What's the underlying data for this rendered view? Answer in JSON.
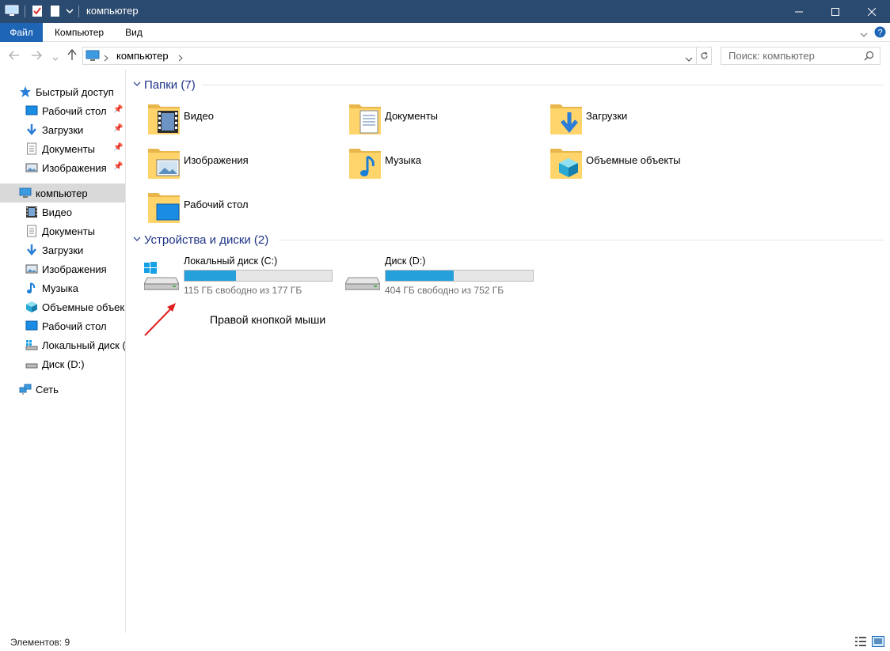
{
  "window": {
    "title": "компьютер"
  },
  "ribbon": {
    "tabs": [
      "Файл",
      "Компьютер",
      "Вид"
    ]
  },
  "address": {
    "crumb": "компьютер"
  },
  "search": {
    "placeholder": "Поиск: компьютер"
  },
  "sidebar": {
    "quick_access": "Быстрый доступ",
    "quick_items": [
      {
        "label": "Рабочий стол",
        "icon": "desktop-icon"
      },
      {
        "label": "Загрузки",
        "icon": "downloads-icon"
      },
      {
        "label": "Документы",
        "icon": "documents-icon"
      },
      {
        "label": "Изображения",
        "icon": "pictures-icon"
      }
    ],
    "computer": "компьютер",
    "computer_items": [
      {
        "label": "Видео",
        "icon": "video-icon"
      },
      {
        "label": "Документы",
        "icon": "documents-icon"
      },
      {
        "label": "Загрузки",
        "icon": "downloads-icon"
      },
      {
        "label": "Изображения",
        "icon": "pictures-icon"
      },
      {
        "label": "Музыка",
        "icon": "music-icon"
      },
      {
        "label": "Объемные объек",
        "icon": "3d-objects-icon"
      },
      {
        "label": "Рабочий стол",
        "icon": "desktop-icon"
      },
      {
        "label": "Локальный диск (",
        "icon": "drive-c-icon"
      },
      {
        "label": "Диск (D:)",
        "icon": "drive-d-icon"
      }
    ],
    "network": "Сеть"
  },
  "main": {
    "folders_header": "Папки (7)",
    "folders": [
      {
        "label": "Видео",
        "icon": "video-folder-icon"
      },
      {
        "label": "Документы",
        "icon": "documents-folder-icon"
      },
      {
        "label": "Загрузки",
        "icon": "downloads-folder-icon"
      },
      {
        "label": "Изображения",
        "icon": "pictures-folder-icon"
      },
      {
        "label": "Музыка",
        "icon": "music-folder-icon"
      },
      {
        "label": "Объемные объекты",
        "icon": "3d-objects-folder-icon"
      },
      {
        "label": "Рабочий стол",
        "icon": "desktop-folder-icon"
      }
    ],
    "devices_header": "Устройства и диски (2)",
    "drives": [
      {
        "name": "Локальный диск (C:)",
        "free": "115 ГБ свободно из 177 ГБ",
        "used_fraction": 0.35
      },
      {
        "name": "Диск (D:)",
        "free": "404 ГБ свободно из 752 ГБ",
        "used_fraction": 0.46
      }
    ],
    "annotation": "Правой кнопкой мыши"
  },
  "status": {
    "count": "Элементов: 9"
  },
  "colors": {
    "titlebar": "#2b4a6f",
    "file_tab": "#1e65b5",
    "drive_fill": "#26a0da",
    "header_text": "#1e3287",
    "annotation_arrow": "#e02020"
  }
}
